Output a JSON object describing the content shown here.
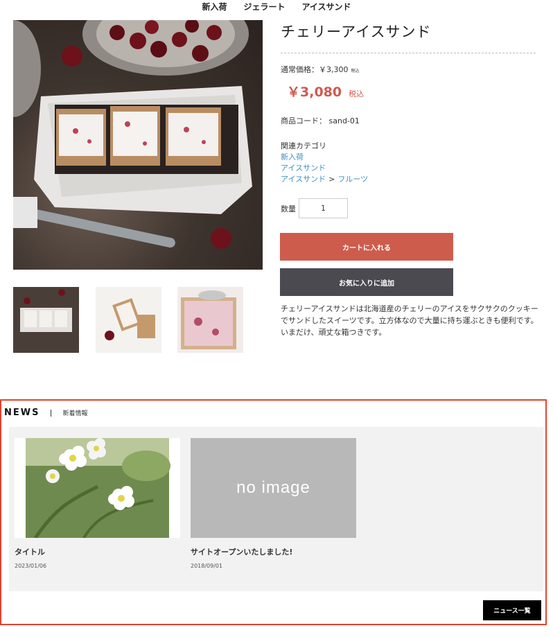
{
  "nav": {
    "items": [
      "新入荷",
      "ジェラート",
      "アイスサンド"
    ]
  },
  "product": {
    "title": "チェリーアイスサンド",
    "regular_price_label": "通常価格：￥3,300",
    "regular_price_tax": "税込",
    "sale_price": "￥3,080",
    "sale_price_tax": "税込",
    "code_label": "商品コード：",
    "code_value": "sand-01",
    "categories_label": "関連カテゴリ",
    "categories": [
      "新入荷",
      "アイスサンド"
    ],
    "category_path": [
      "アイスサンド",
      "フルーツ"
    ],
    "category_separator": ">",
    "quantity_label": "数量",
    "quantity_value": "1",
    "add_to_cart": "カートに入れる",
    "add_to_favorites": "お気に入りに追加",
    "description": [
      "チェリーアイスサンドは北海道産のチェリーのアイスをサクサクのクッキーでサンドしたスイーツです。立方体なので大量に持ち運ぶときも便利です。",
      "いまだけ、頑丈な箱つきです。"
    ]
  },
  "news": {
    "title": "NEWS",
    "subtitle": "新着情報",
    "items": [
      {
        "title": "タイトル",
        "date": "2023/01/06"
      },
      {
        "title": "サイトオープンいたしました!",
        "date": "2018/09/01",
        "placeholder": "no image"
      }
    ],
    "more_button": "ニュース一覧"
  },
  "colors": {
    "sale": "#cf5a4f",
    "cart_button": "#cd5c4d",
    "fav_button": "#4b4a51",
    "link": "#3b8fc4",
    "news_border": "#e5432f"
  }
}
